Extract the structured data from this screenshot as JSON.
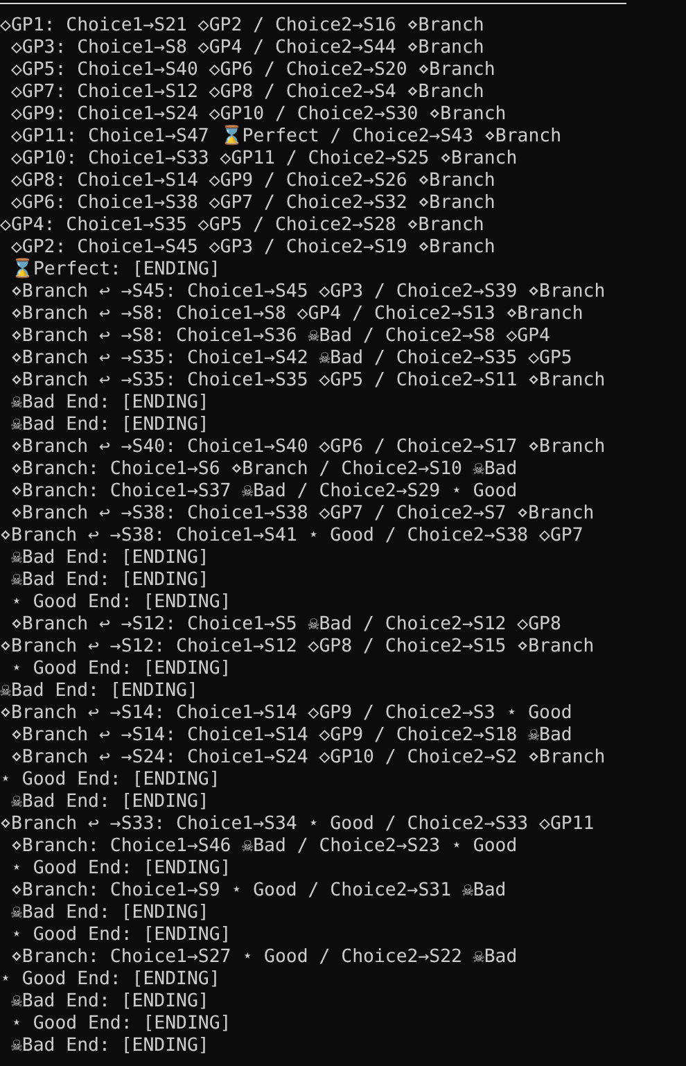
{
  "terminal": {
    "lines": [
      "◇GP1: Choice1→S21 ◇GP2 / Choice2→S16 ⋄Branch",
      " ◇GP3: Choice1→S8 ◇GP4 / Choice2→S44 ⋄Branch",
      " ◇GP5: Choice1→S40 ◇GP6 / Choice2→S20 ⋄Branch",
      " ◇GP7: Choice1→S12 ◇GP8 / Choice2→S4 ⋄Branch",
      " ◇GP9: Choice1→S24 ◇GP10 / Choice2→S30 ⋄Branch",
      " ◇GP11: Choice1→S47 ⌛Perfect / Choice2→S43 ⋄Branch",
      " ◇GP10: Choice1→S33 ◇GP11 / Choice2→S25 ⋄Branch",
      " ◇GP8: Choice1→S14 ◇GP9 / Choice2→S26 ⋄Branch",
      " ◇GP6: Choice1→S38 ◇GP7 / Choice2→S32 ⋄Branch",
      "◇GP4: Choice1→S35 ◇GP5 / Choice2→S28 ⋄Branch",
      " ◇GP2: Choice1→S45 ◇GP3 / Choice2→S19 ⋄Branch",
      " ⌛Perfect: [ENDING]",
      " ⋄Branch ↩ →S45: Choice1→S45 ◇GP3 / Choice2→S39 ⋄Branch",
      " ⋄Branch ↩ →S8: Choice1→S8 ◇GP4 / Choice2→S13 ⋄Branch",
      " ⋄Branch ↩ →S8: Choice1→S36 ☠Bad / Choice2→S8 ◇GP4",
      " ⋄Branch ↩ →S35: Choice1→S42 ☠Bad / Choice2→S35 ◇GP5",
      " ⋄Branch ↩ →S35: Choice1→S35 ◇GP5 / Choice2→S11 ⋄Branch",
      " ☠Bad End: [ENDING]",
      " ☠Bad End: [ENDING]",
      " ⋄Branch ↩ →S40: Choice1→S40 ◇GP6 / Choice2→S17 ⋄Branch",
      " ⋄Branch: Choice1→S6 ⋄Branch / Choice2→S10 ☠Bad",
      " ⋄Branch: Choice1→S37 ☠Bad / Choice2→S29 ⋆ Good",
      " ⋄Branch ↩ →S38: Choice1→S38 ◇GP7 / Choice2→S7 ⋄Branch",
      "⋄Branch ↩ →S38: Choice1→S41 ⋆ Good / Choice2→S38 ◇GP7",
      " ☠Bad End: [ENDING]",
      " ☠Bad End: [ENDING]",
      " ⋆ Good End: [ENDING]",
      " ⋄Branch ↩ →S12: Choice1→S5 ☠Bad / Choice2→S12 ◇GP8",
      "⋄Branch ↩ →S12: Choice1→S12 ◇GP8 / Choice2→S15 ⋄Branch",
      " ⋆ Good End: [ENDING]",
      "☠Bad End: [ENDING]",
      "⋄Branch ↩ →S14: Choice1→S14 ◇GP9 / Choice2→S3 ⋆ Good",
      " ⋄Branch ↩ →S14: Choice1→S14 ◇GP9 / Choice2→S18 ☠Bad",
      " ⋄Branch ↩ →S24: Choice1→S24 ◇GP10 / Choice2→S2 ⋄Branch",
      "⋆ Good End: [ENDING]",
      " ☠Bad End: [ENDING]",
      "⋄Branch ↩ →S33: Choice1→S34 ⋆ Good / Choice2→S33 ◇GP11",
      " ⋄Branch: Choice1→S46 ☠Bad / Choice2→S23 ⋆ Good",
      " ⋆ Good End: [ENDING]",
      " ⋄Branch: Choice1→S9 ⋆ Good / Choice2→S31 ☠Bad",
      " ☠Bad End: [ENDING]",
      " ⋆ Good End: [ENDING]",
      " ⋄Branch: Choice1→S27 ⋆ Good / Choice2→S22 ☠Bad",
      "⋆ Good End: [ENDING]",
      " ☠Bad End: [ENDING]",
      " ⋆ Good End: [ENDING]",
      " ☠Bad End: [ENDING]"
    ]
  }
}
